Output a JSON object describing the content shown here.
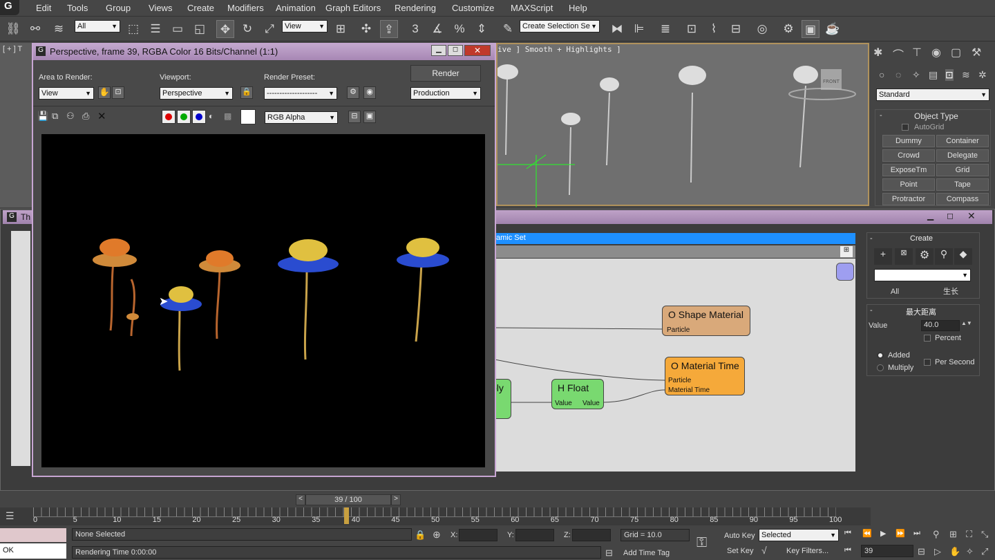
{
  "app": {
    "logo": "G"
  },
  "menu": [
    "Edit",
    "Tools",
    "Group",
    "Views",
    "Create",
    "Modifiers",
    "Animation",
    "Graph Editors",
    "Rendering",
    "Customize",
    "MAXScript",
    "Help"
  ],
  "toolbar": {
    "filter": "All",
    "ref_coord": "View",
    "selection_set": "Create Selection Se",
    "snap_label": "3"
  },
  "viewport": {
    "label": "ive ] Smooth + Highlights ]",
    "left_label": "[ + ] T",
    "front_label": "FRONT"
  },
  "command_panel": {
    "category": "Standard",
    "rollout": "Object Type",
    "autogrid": "AutoGrid",
    "buttons": [
      "Dummy",
      "Container",
      "Crowd",
      "Delegate",
      "ExposeTm",
      "Grid",
      "Point",
      "Tape",
      "Protractor",
      "Compass"
    ]
  },
  "render_window": {
    "title": "Perspective, frame 39, RGBA Color 16 Bits/Channel (1:1)",
    "area_label": "Area to Render:",
    "area_value": "View",
    "viewport_label": "Viewport:",
    "viewport_value": "Perspective",
    "preset_label": "Render Preset:",
    "preset_value": "--------------------",
    "render_button": "Render",
    "production": "Production",
    "channel": "RGB Alpha"
  },
  "slate": {
    "title": "Th",
    "tab": "amic Set",
    "create_header": "Create",
    "all_tab": "All",
    "grow_tab": "生长",
    "param_header": "最大距离",
    "value_label": "Value",
    "value": "40.0",
    "percent": "Percent",
    "added": "Added",
    "multiply": "Multiply",
    "per_second": "Per Second",
    "nodes": {
      "shape_material": {
        "title": "O Shape Material",
        "port": "Particle",
        "color": "#d9a97a"
      },
      "material_time": {
        "title": "O Material Time",
        "port1": "Particle",
        "port2": "Material Time",
        "color": "#f5a93a"
      },
      "h_float": {
        "title": "H Float",
        "in": "Value",
        "out": "Value",
        "color": "#79d970"
      },
      "ply": {
        "title": "ply",
        "color": "#79d970"
      }
    }
  },
  "timeline": {
    "frame": "39 / 100",
    "ticks": [
      "0",
      "5",
      "10",
      "15",
      "20",
      "25",
      "30",
      "35",
      "40",
      "45",
      "50",
      "55",
      "60",
      "65",
      "70",
      "75",
      "80",
      "85",
      "90",
      "95",
      "100"
    ]
  },
  "status": {
    "selection": "None Selected",
    "render_time": "Rendering Time 0:00:00",
    "x_label": "X:",
    "y_label": "Y:",
    "z_label": "Z:",
    "grid": "Grid = 10.0",
    "add_time_tag": "Add Time Tag",
    "auto_key": "Auto Key",
    "set_key": "Set Key",
    "selected": "Selected",
    "key_filters": "Key Filters...",
    "frame": "39",
    "ok": "OK"
  }
}
